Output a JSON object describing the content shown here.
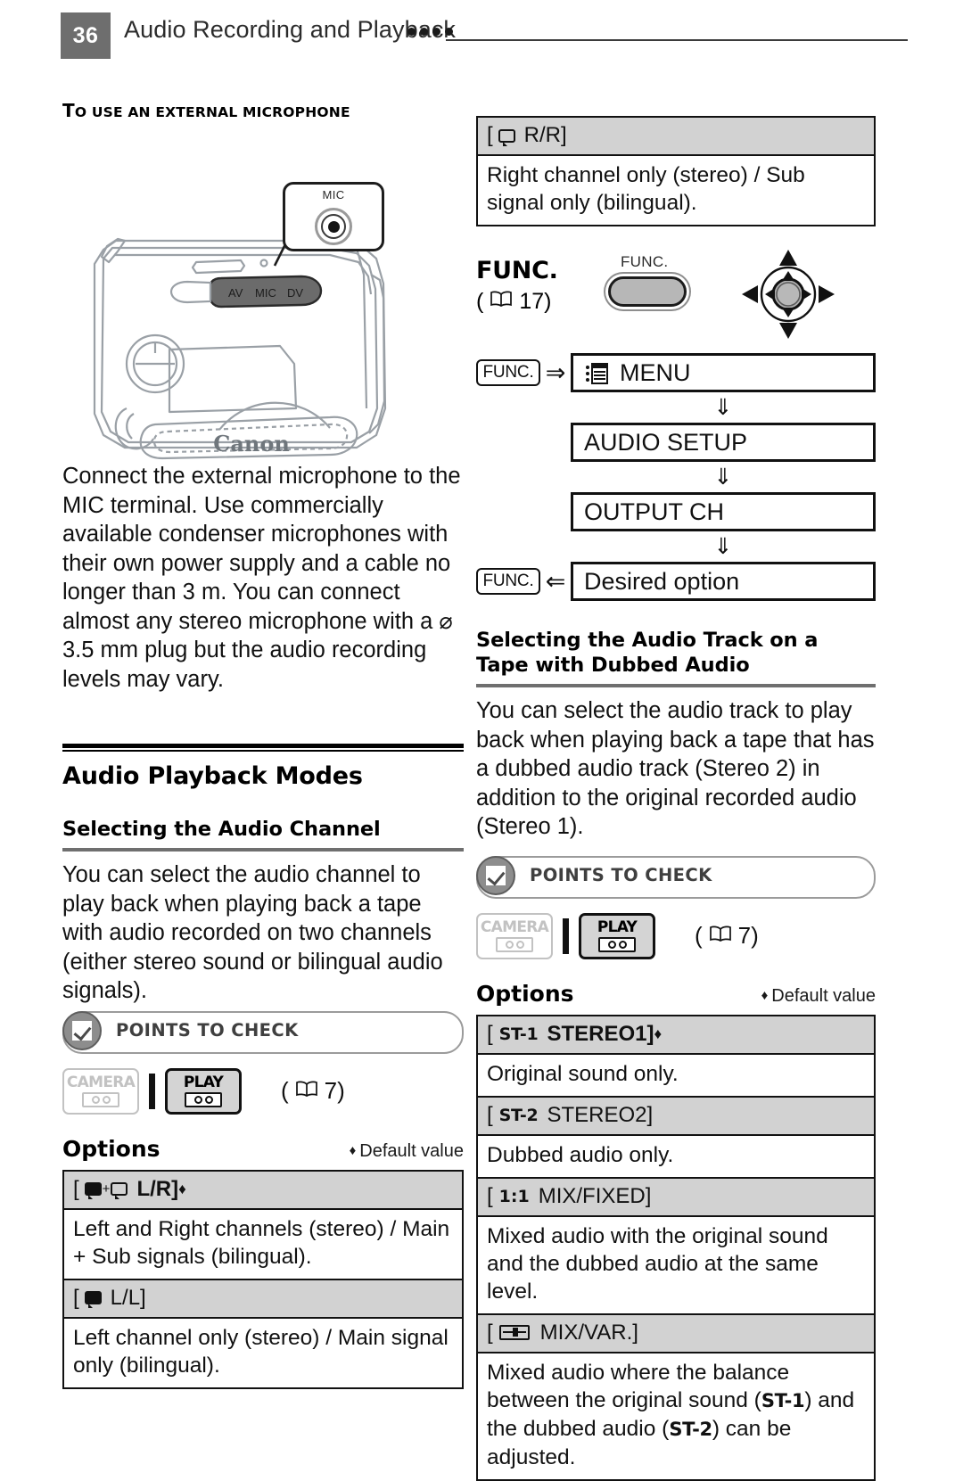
{
  "header": {
    "page_number": "36",
    "title": "Audio Recording and Playback",
    "dots_count": 4
  },
  "left_column": {
    "mini_heading": {
      "first_letter": "T",
      "rest": "O USE AN EXTERNAL MICROPHONE",
      "full": "To USE AN EXTERNAL MICROPHONE"
    },
    "illustration": {
      "callout_label": "MIC",
      "terminal_labels": [
        "AV",
        "MIC",
        "DV"
      ],
      "brand": "Canon",
      "icon_name": "camcorder-line-art"
    },
    "body_text": "Connect the external microphone to the MIC terminal. Use commercially available condenser microphones with their own power supply and a cable no longer than 3 m. You can connect almost any stereo microphone with a ⌀ 3.5 mm plug but the audio recording levels may vary.",
    "section_title": "Audio Playback Modes",
    "subsection_title": "Selecting the Audio Channel",
    "subsection_body": "You can select the audio channel to play back when playing back a tape with audio recorded on two channels (either stereo sound or bilingual audio signals).",
    "points_to_check": {
      "label": "POINTS TO CHECK",
      "modes": [
        {
          "name": "CAMERA",
          "state": "disabled"
        },
        {
          "name": "PLAY",
          "state": "enabled"
        }
      ],
      "page_ref": "7"
    },
    "options": {
      "label": "Options",
      "default_note": "Default value",
      "default_marker": "♦",
      "rows": [
        {
          "header_prefix": "[",
          "icons": [
            "speaker-filled-icon",
            "speaker-outline-icon"
          ],
          "header_label": "L/R]",
          "is_default": true,
          "bold": true,
          "description": "Left and Right channels (stereo) / Main + Sub signals (bilingual)."
        },
        {
          "header_prefix": "[",
          "icons": [
            "speaker-filled-icon"
          ],
          "header_label": "L/L]",
          "is_default": false,
          "bold": false,
          "description": "Left channel only (stereo) / Main signal only (bilingual)."
        }
      ]
    }
  },
  "right_column": {
    "top_option": {
      "header_prefix": "[",
      "icons": [
        "speaker-outline-icon"
      ],
      "header_label": "R/R]",
      "description": "Right channel only (stereo) / Sub signal only (bilingual)."
    },
    "func_block": {
      "word": "FUNC.",
      "page_ref": "17",
      "button_label": "FUNC.",
      "joystick_icon": "joystick-4way-icon"
    },
    "menu_flow": [
      {
        "key": "FUNC.",
        "arrow": "⇒",
        "box": "MENU",
        "icon": "menu-list-icon"
      },
      {
        "key": "",
        "arrow": "",
        "box": "AUDIO  SETUP",
        "icon": ""
      },
      {
        "key": "",
        "arrow": "",
        "box": "OUTPUT CH",
        "icon": ""
      },
      {
        "key": "FUNC.",
        "arrow": "⇐",
        "box": "Desired option",
        "icon": ""
      }
    ],
    "flow_down_arrow": "⇓",
    "subsection_title": "Selecting the Audio Track on a Tape with Dubbed Audio",
    "subsection_body": "You can select the audio track to play back when playing back a tape that has a dubbed audio track (Stereo 2) in addition to the original recorded audio (Stereo 1).",
    "points_to_check": {
      "label": "POINTS TO CHECK",
      "modes": [
        {
          "name": "CAMERA",
          "state": "disabled"
        },
        {
          "name": "PLAY",
          "state": "enabled"
        }
      ],
      "page_ref": "7"
    },
    "options": {
      "label": "Options",
      "default_note": "Default value",
      "default_marker": "♦",
      "rows": [
        {
          "badge": "ST-1",
          "header_label": "STEREO1]",
          "is_default": true,
          "bold": true,
          "description": "Original sound only."
        },
        {
          "badge": "ST-2",
          "header_label": "STEREO2]",
          "is_default": false,
          "bold": false,
          "description": "Dubbed audio only."
        },
        {
          "badge": "1:1",
          "header_label": "MIX/FIXED]",
          "is_default": false,
          "bold": false,
          "description": "Mixed audio with the original sound and the dubbed audio at the same level."
        },
        {
          "badge": "slider-icon",
          "header_label": "MIX/VAR.]",
          "is_default": false,
          "bold": false,
          "description_parts": {
            "a": "Mixed audio where the balance between the original sound (",
            "b": "ST-1",
            "c": ") and the dubbed audio (",
            "d": "ST-2",
            "e": ") can be adjusted."
          }
        }
      ]
    }
  },
  "colors": {
    "page_badge": "#6e6e6e",
    "table_header": "#d2d2d2",
    "rule": "#6f6f6f",
    "disabled": "#c2c2c2",
    "enabled_fill": "#d4d4d4"
  }
}
